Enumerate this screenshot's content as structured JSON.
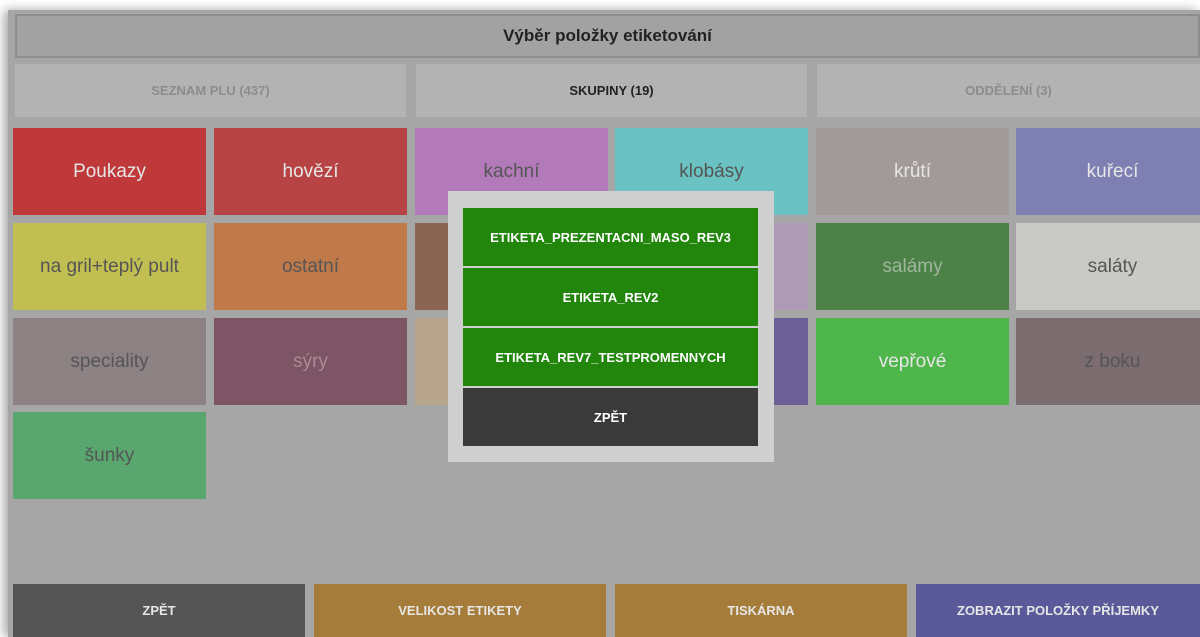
{
  "title": "Výběr položky etiketování",
  "tabs": [
    {
      "label": "SEZNAM PLU (437)",
      "active": false
    },
    {
      "label": "SKUPINY (19)",
      "active": true
    },
    {
      "label": "ODDĚLENÍ (3)",
      "active": false
    }
  ],
  "groups": [
    {
      "label": "Poukazy",
      "color": "#c0393a"
    },
    {
      "label": "hovězí",
      "color": "#b84344"
    },
    {
      "label": "kachní",
      "color": "#b27ab8"
    },
    {
      "label": "klobásy",
      "color": "#6bc2c2"
    },
    {
      "label": "krůtí",
      "color": "#a29a98"
    },
    {
      "label": "kuřecí",
      "color": "#7e7fb3"
    },
    {
      "label": "na gril+teplý pult",
      "color": "#c1bf52"
    },
    {
      "label": "ostatní",
      "color": "#c07a4a"
    },
    {
      "label": "",
      "color": "#8a6652"
    },
    {
      "label": "",
      "color": "#ad9ab5"
    },
    {
      "label": "salámy",
      "color": "#4c8148"
    },
    {
      "label": "saláty",
      "color": "#c9c9c6"
    },
    {
      "label": "speciality",
      "color": "#8c8283"
    },
    {
      "label": "sýry",
      "color": "#7d5564"
    },
    {
      "label": "",
      "color": "#b7a68c"
    },
    {
      "label": "",
      "color": "#6c5f95"
    },
    {
      "label": "vepřové",
      "color": "#4fb64b"
    },
    {
      "label": "z boku",
      "color": "#7b6c70"
    },
    {
      "label": "šunky",
      "color": "#5aa66f"
    }
  ],
  "modal": {
    "options": [
      "ETIKETA_PREZENTACNI_MASO_REV3",
      "ETIKETA_REV2",
      "ETIKETA_REV7_TESTPROMENNYCH"
    ],
    "back_label": "ZPĚT",
    "option_color": "#22860c",
    "back_color": "#3a3a3a"
  },
  "bottom_bar": [
    {
      "label": "ZPĚT",
      "color": "#555555"
    },
    {
      "label": "VELIKOST ETIKETY",
      "color": "#a67c3a"
    },
    {
      "label": "TISKÁRNA",
      "color": "#a67c3a"
    },
    {
      "label": "ZOBRAZIT POLOŽKY PŘÍJEMKY",
      "color": "#5a5a9a"
    }
  ]
}
